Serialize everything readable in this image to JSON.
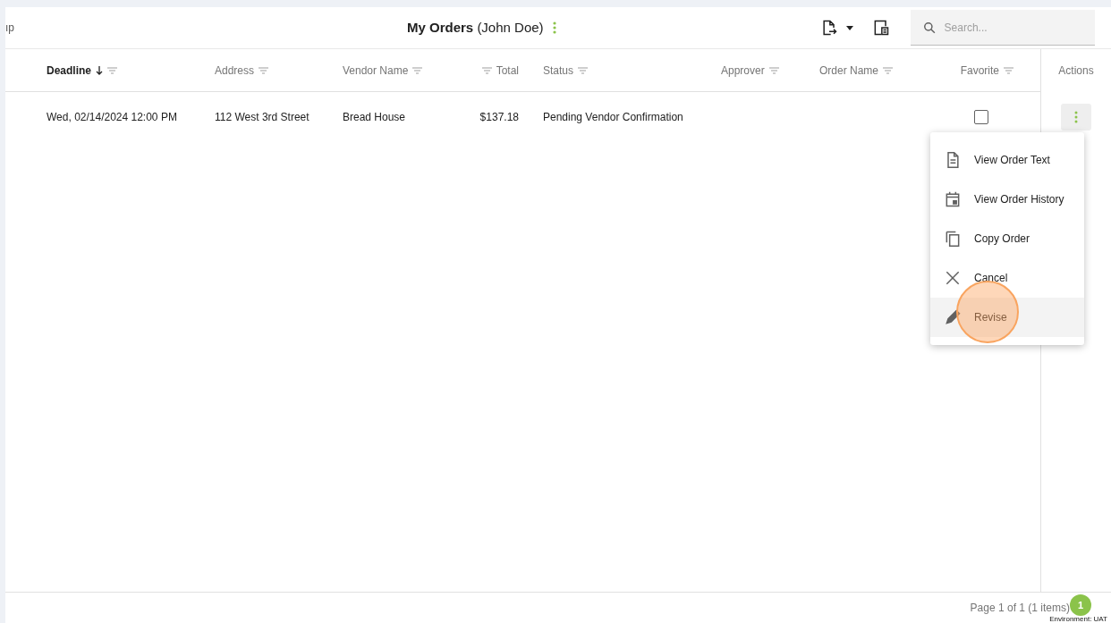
{
  "header": {
    "left_text": "ıp",
    "title": "My Orders",
    "subtitle": "(John Doe)",
    "search": {
      "placeholder": "Search..."
    }
  },
  "table": {
    "columns": [
      {
        "label": "Deadline",
        "sorted": true
      },
      {
        "label": "Address",
        "sorted": false
      },
      {
        "label": "Vendor Name",
        "sorted": false
      },
      {
        "label": "Total",
        "sorted": false
      },
      {
        "label": "Status",
        "sorted": false
      },
      {
        "label": "Approver",
        "sorted": false
      },
      {
        "label": "Order Name",
        "sorted": false
      },
      {
        "label": "Favorite",
        "sorted": false
      }
    ],
    "actions_label": "Actions",
    "rows": [
      {
        "cells": [
          "Wed, 02/14/2024 12:00 PM",
          "112 West 3rd Street",
          "Bread House",
          "$137.18",
          "Pending Vendor Confirmation"
        ],
        "favorite": false
      }
    ]
  },
  "menu": [
    {
      "kind": "doc",
      "label": "View Order Text",
      "selected": false
    },
    {
      "kind": "calendar",
      "label": "View Order History",
      "selected": false
    },
    {
      "kind": "copy",
      "label": "Copy Order",
      "selected": false
    },
    {
      "kind": "close",
      "label": "Cancel",
      "selected": false
    },
    {
      "kind": "pencil",
      "label": "Revise",
      "selected": true
    }
  ],
  "footer": {
    "pager": "Page 1 of 1 (1 items)",
    "badge": "1",
    "environment": "Environment: UAT"
  }
}
